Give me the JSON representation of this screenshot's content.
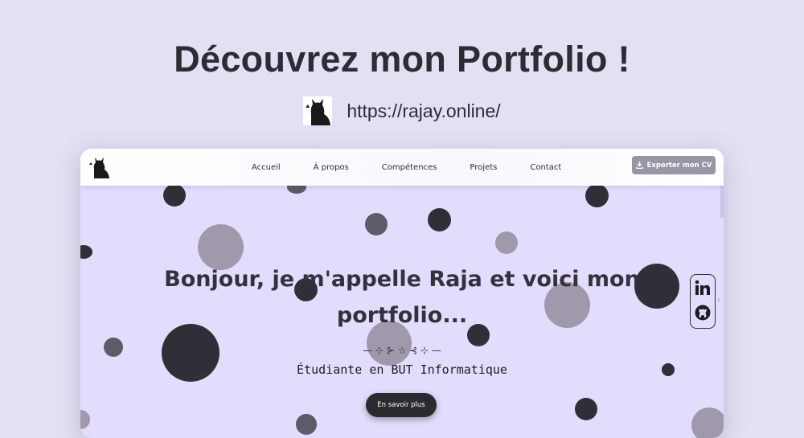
{
  "header": {
    "title": "Découvrez mon Portfolio !",
    "url": "https://rajay.online/"
  },
  "navbar": {
    "links": [
      "Accueil",
      "À propos",
      "Compétences",
      "Projets",
      "Contact"
    ],
    "cv_button": "Exporter mon CV"
  },
  "hero": {
    "title": "Bonjour, je m'appelle Raja et voici mon portfolio...",
    "divider": "— ⊹ ⊱ ☆ ⊰ ⊹ —",
    "subtitle": "Étudiante en BUT Informatique",
    "cta": "En savoir plus"
  },
  "social": {
    "icons": [
      "linkedin-icon",
      "github-icon"
    ]
  },
  "colors": {
    "page_bg": "#e4e0f3",
    "hero_bg": "#e2ddfd",
    "dark_dot": "#302e36",
    "light_dot": "#9f99ab",
    "cv_button": "#9a95a6",
    "cta_button": "#2c2a30"
  }
}
